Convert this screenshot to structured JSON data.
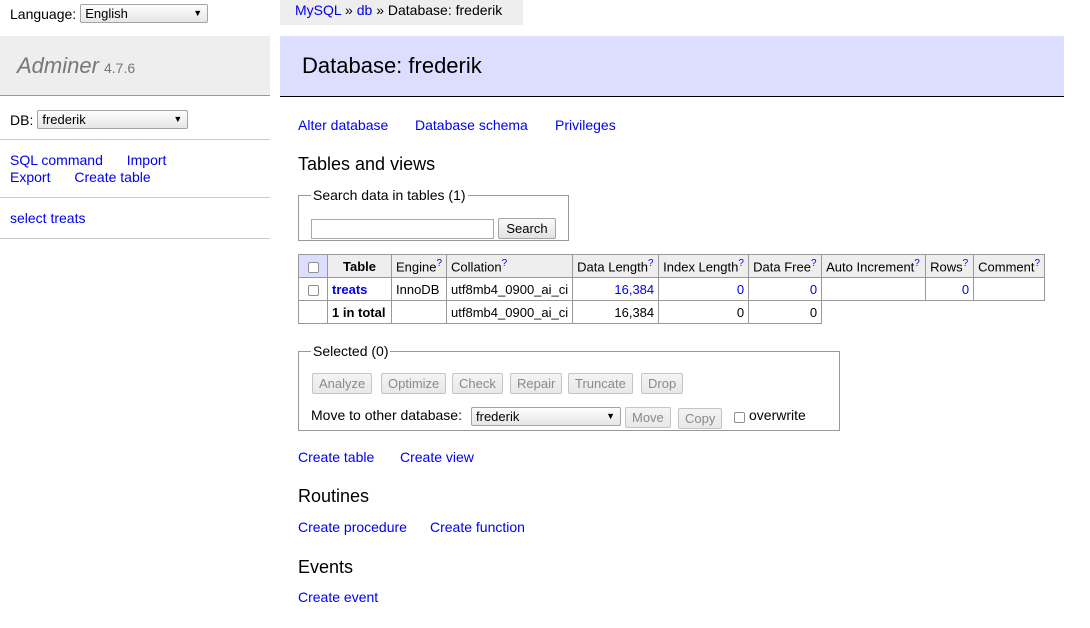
{
  "sidebar": {
    "language_label": "Language:",
    "language_value": "English",
    "app_name": "Adminer",
    "version": "4.7.6",
    "db_label": "DB:",
    "db_value": "frederik",
    "links": {
      "sql_command": "SQL command",
      "import": "Import",
      "export": "Export",
      "create_table": "Create table"
    },
    "tables": [
      "select treats"
    ]
  },
  "breadcrumb": {
    "server": "MySQL",
    "sep1": "»",
    "driver": "db",
    "sep2": "»",
    "current": "Database: frederik"
  },
  "heading": "Database: frederik",
  "db_links": {
    "alter": "Alter database",
    "schema": "Database schema",
    "privileges": "Privileges"
  },
  "tables_section": {
    "title": "Tables and views",
    "search_legend": "Search data in tables (1)",
    "search_value": "",
    "search_button": "Search",
    "columns": {
      "table": "Table",
      "engine": "Engine",
      "collation": "Collation",
      "data_length": "Data Length",
      "index_length": "Index Length",
      "data_free": "Data Free",
      "auto_increment": "Auto Increment",
      "rows": "Rows",
      "comment": "Comment",
      "help_mark": "?"
    },
    "row": {
      "name": "treats",
      "engine": "InnoDB",
      "collation": "utf8mb4_0900_ai_ci",
      "data_length": "16,384",
      "index_length": "0",
      "data_free": "0",
      "auto_increment": "",
      "rows": "0",
      "comment": ""
    },
    "total": {
      "label": "1 in total",
      "engine": "",
      "collation": "utf8mb4_0900_ai_ci",
      "data_length": "16,384",
      "index_length": "0",
      "data_free": "0"
    }
  },
  "selected": {
    "legend": "Selected (0)",
    "buttons": {
      "analyze": "Analyze",
      "optimize": "Optimize",
      "check": "Check",
      "repair": "Repair",
      "truncate": "Truncate",
      "drop": "Drop"
    },
    "move_label": "Move to other database:",
    "move_db": "frederik",
    "move_button": "Move",
    "copy_button": "Copy",
    "overwrite_label": "overwrite"
  },
  "create_links": {
    "table": "Create table",
    "view": "Create view"
  },
  "routines": {
    "title": "Routines",
    "procedure": "Create procedure",
    "function": "Create function"
  },
  "events": {
    "title": "Events",
    "create": "Create event"
  }
}
